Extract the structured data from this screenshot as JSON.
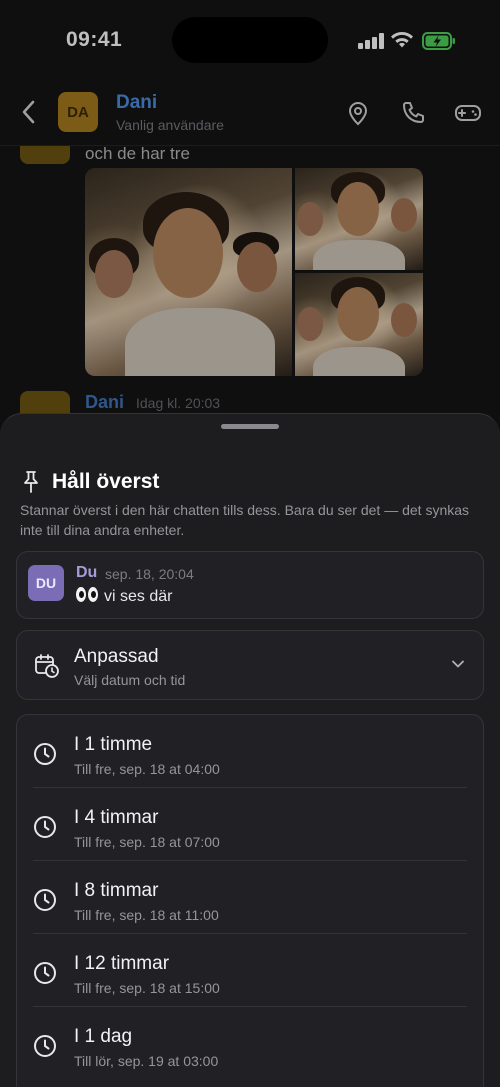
{
  "status_bar": {
    "time": "09:41"
  },
  "chat_header": {
    "avatar_initials": "DA",
    "name": "Dani",
    "subtitle": "Vanlig användare",
    "icons": [
      "back-chevron-icon",
      "location-pin-icon",
      "phone-icon",
      "gamepad-icon"
    ]
  },
  "chat": {
    "message_text": "och de har tre",
    "next_sender": "Dani",
    "next_time": "Idag kl. 20:03",
    "next_avatar_initials": "DA"
  },
  "sheet": {
    "title": "Håll överst",
    "description": "Stannar överst i den här chatten tills dess. Bara du ser det — det synkas inte till dina andra enheter.",
    "pinned_message": {
      "avatar_initials": "DU",
      "sender": "Du",
      "time": "sep. 18, 20:04",
      "emoji": "👀",
      "text": "vi ses där"
    },
    "custom": {
      "title": "Anpassad",
      "subtitle": "Välj datum och tid"
    },
    "options": [
      {
        "title": "I 1 timme",
        "subtitle": "Till fre, sep. 18 at 04:00"
      },
      {
        "title": "I 4 timmar",
        "subtitle": "Till fre, sep. 18 at 07:00"
      },
      {
        "title": "I 8 timmar",
        "subtitle": "Till fre, sep. 18 at 11:00"
      },
      {
        "title": "I 12 timmar",
        "subtitle": "Till fre, sep. 18 at 15:00"
      },
      {
        "title": "I 1 dag",
        "subtitle": "Till lör, sep. 19 at 03:00"
      }
    ]
  },
  "colors": {
    "accent_name": "#4d8fe0",
    "avatar_dani": "#a57a1c",
    "avatar_du": "#7b6cb6",
    "sheet_bg": "#1d1d20"
  }
}
